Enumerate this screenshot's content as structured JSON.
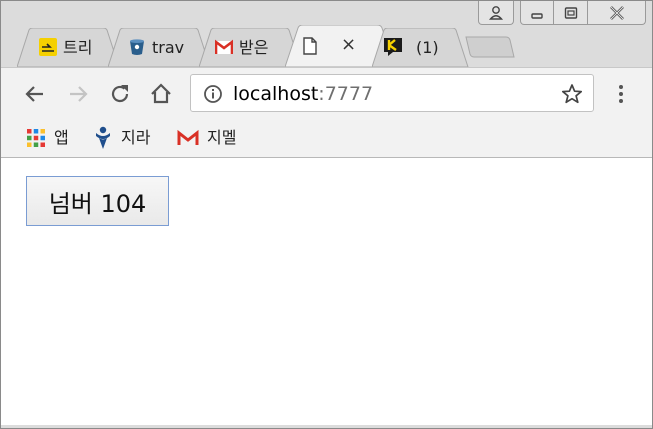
{
  "window_controls": {
    "profile_icon": "person-icon",
    "minimize_icon": "minimize-icon",
    "maximize_icon": "restore-icon",
    "close_icon": "close-x-icon"
  },
  "tabs": [
    {
      "title": "트리",
      "favicon": "boarding-pass-icon",
      "favicon_color": "#f5d000"
    },
    {
      "title": "trav",
      "favicon": "bucket-icon",
      "favicon_color": "#2a5e8c"
    },
    {
      "title": "받은",
      "favicon": "gmail-icon",
      "favicon_color": "#d93025"
    },
    {
      "title": "",
      "favicon": "page-icon",
      "active": true,
      "close": "×"
    },
    {
      "title": "(1)",
      "favicon": "k-chat-icon",
      "favicon_color": "#f5d000"
    }
  ],
  "toolbar": {
    "back_icon": "arrow-left-icon",
    "forward_icon": "arrow-right-icon",
    "reload_icon": "reload-icon",
    "home_icon": "home-icon",
    "info_icon": "info-icon",
    "url_host": "localhost",
    "url_port": ":7777",
    "star_icon": "star-icon",
    "menu_icon": "kebab-menu-icon"
  },
  "bookmarks": [
    {
      "label": "앱",
      "icon": "apps-grid-icon"
    },
    {
      "label": "지라",
      "icon": "jira-icon"
    },
    {
      "label": "지멜",
      "icon": "gmail-icon"
    }
  ],
  "page": {
    "button_label": "넘버 104"
  },
  "colors": {
    "chrome_bg": "#dcdcdc",
    "toolbar_bg": "#f2f2f2",
    "button_border": "#7a9cd3",
    "gmail_red": "#d93025",
    "jira_blue": "#1f4e8c"
  }
}
